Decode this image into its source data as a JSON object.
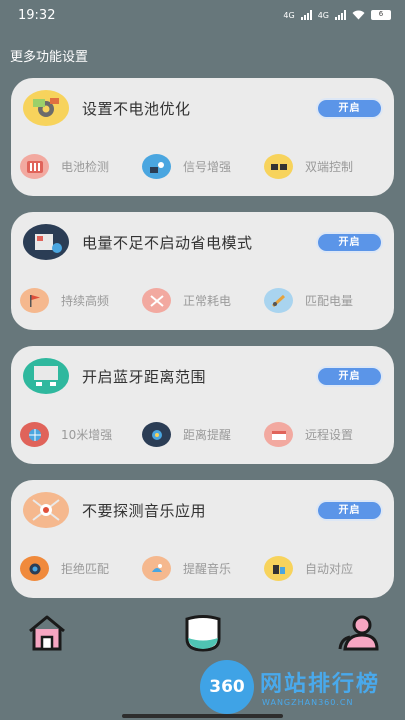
{
  "status": {
    "time": "19:32",
    "net1": "4G",
    "net2": "4G",
    "battery": "6"
  },
  "section_title": "更多功能设置",
  "cards": [
    {
      "title": "设置不电池优化",
      "toggle_label": "开启",
      "features": [
        {
          "label": "电池检测"
        },
        {
          "label": "信号增强"
        },
        {
          "label": "双端控制"
        }
      ]
    },
    {
      "title": "电量不足不启动省电模式",
      "toggle_label": "开启",
      "features": [
        {
          "label": "持续高频"
        },
        {
          "label": "正常耗电"
        },
        {
          "label": "匹配电量"
        }
      ]
    },
    {
      "title": "开启蓝牙距离范围",
      "toggle_label": "开启",
      "features": [
        {
          "label": "10米增强"
        },
        {
          "label": "距离提醒"
        },
        {
          "label": "远程设置"
        }
      ]
    },
    {
      "title": "不要探测音乐应用",
      "toggle_label": "开启",
      "features": [
        {
          "label": "拒绝匹配"
        },
        {
          "label": "提醒音乐"
        },
        {
          "label": "自动对应"
        }
      ]
    }
  ],
  "watermark": {
    "logo": "360",
    "text": "网站排行榜",
    "sub": "WANGZHAN360.CN"
  },
  "colors": {
    "background": "#67777b",
    "card": "#ebebeb",
    "toggle": "#5b95e8",
    "nav_icon": "#f7a6c2"
  }
}
